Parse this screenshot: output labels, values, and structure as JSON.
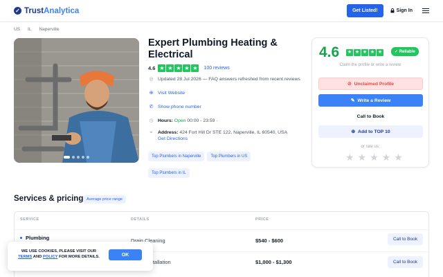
{
  "header": {
    "logo_part1": "Trust",
    "logo_part2": "Analytica",
    "get_listed": "Get Listed!",
    "sign_in": "Sign In"
  },
  "breadcrumb": [
    "US",
    "IL",
    "Naperville"
  ],
  "photo": {
    "dots_total": 5,
    "active_dot": 1
  },
  "business": {
    "title": "Expert Plumbing Heating & Electrical",
    "rating": "4.6",
    "stars": 5,
    "reviews": "100 reviews",
    "updated": "Updated 28 Jul 2026 — FAQ answers refreshed from recent reviews",
    "visit_website": "Visit Website",
    "show_phone": "Show phone number",
    "hours_label": "Hours:",
    "hours_status": "Open",
    "hours_time": "00:00 - 23:59 ·",
    "address_label": "Address:",
    "address": "424 Fort Hill Dr STE 122, Naperville, IL 60540, USA",
    "directions": "Get Directions",
    "chips": [
      "Top Plumbers in Naperville",
      "Top Plumbers in US",
      "Top Plumbers in IL"
    ]
  },
  "card": {
    "score": "4.6",
    "reliable": "Reliable",
    "subtitle": "Claim the profile or write a review",
    "unclaimed": "Unclaimed Profile",
    "write_review": "Write a Review",
    "call_to_book": "Call to Book",
    "add_top10": "Add to TOP 10",
    "rate_us": "or rate us:",
    "rate_stars": 5
  },
  "services": {
    "title": "Services & pricing",
    "avg_chip": "Average price range",
    "columns": [
      "SERVICE",
      "DETAILS",
      "PRICE"
    ],
    "rows": [
      {
        "service": "Plumbing",
        "details": "Drain Cleaning",
        "price": "$540 - $600",
        "action": "Call to Book"
      },
      {
        "service": "",
        "details": "Water Installation",
        "price": "$1,000 - $1,300",
        "action": "Call to Book"
      }
    ]
  },
  "cookie": {
    "text_pre": "WE USE COOKIES, PLEASE VISIT OUR",
    "terms": "TERMS",
    "and": "AND",
    "policy": "POLICY",
    "text_post": "FOR MORE DETAILS.",
    "ok": "OK"
  },
  "colors": {
    "primary": "#3b82f6",
    "brand_dark": "#1e3a8a",
    "rating_green": "#22c55e",
    "unclaimed_red": "#ef4444"
  }
}
